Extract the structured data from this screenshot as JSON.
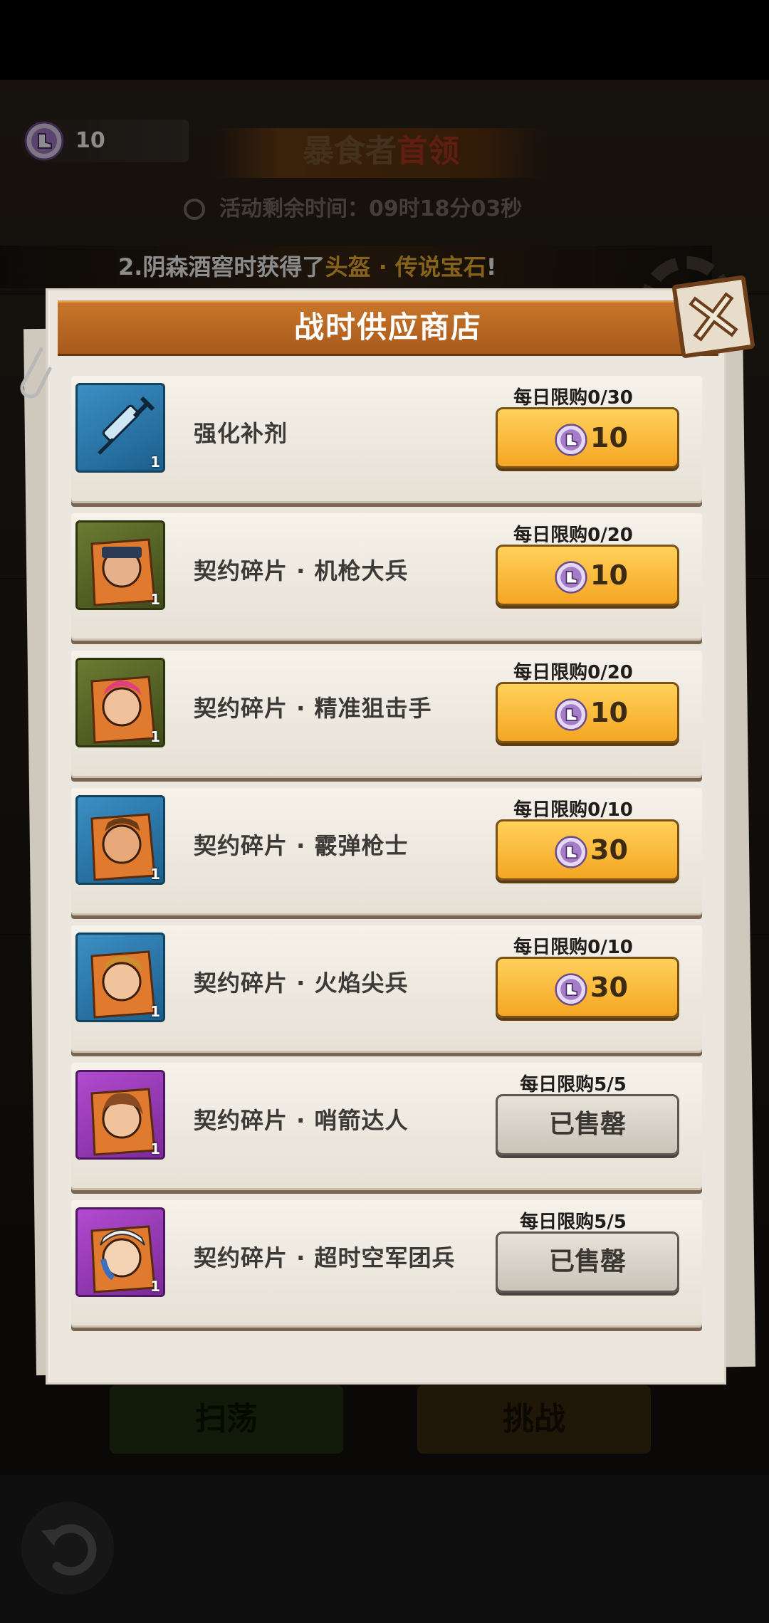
{
  "currency": {
    "amount": "10",
    "icon": "boot-coin-icon"
  },
  "event": {
    "title_main": "暴食者",
    "title_highlight": "首领",
    "timer": "活动剩余时间：09时18分03秒"
  },
  "ticker": {
    "prefix": "2.阴森酒窖时获得了",
    "item": "头盔 · 传说宝石",
    "suffix": "!"
  },
  "shop": {
    "title": "战时供应商店",
    "items": [
      {
        "name": "强化补剂",
        "limit": "每日限购0/30",
        "price": "10",
        "qty": "1",
        "sold": false,
        "frame": "blue",
        "icon": "syringe-icon"
      },
      {
        "name": "契约碎片 · 机枪大兵",
        "limit": "每日限购0/20",
        "price": "10",
        "qty": "1",
        "sold": false,
        "frame": "green",
        "icon": "portrait-icon"
      },
      {
        "name": "契约碎片 · 精准狙击手",
        "limit": "每日限购0/20",
        "price": "10",
        "qty": "1",
        "sold": false,
        "frame": "green",
        "icon": "portrait-icon"
      },
      {
        "name": "契约碎片 · 霰弹枪士",
        "limit": "每日限购0/10",
        "price": "30",
        "qty": "1",
        "sold": false,
        "frame": "blue",
        "icon": "portrait-icon"
      },
      {
        "name": "契约碎片 · 火焰尖兵",
        "limit": "每日限购0/10",
        "price": "30",
        "qty": "1",
        "sold": false,
        "frame": "blue",
        "icon": "portrait-icon"
      },
      {
        "name": "契约碎片 · 哨箭达人",
        "limit": "每日限购5/5",
        "price": "已售罄",
        "qty": "1",
        "sold": true,
        "frame": "purple",
        "icon": "portrait-icon"
      },
      {
        "name": "契约碎片 · 超时空军团兵",
        "limit": "每日限购5/5",
        "price": "已售罄",
        "qty": "1",
        "sold": true,
        "frame": "purple",
        "icon": "portrait-icon"
      }
    ]
  },
  "bottom": {
    "sweep_label": "扫荡",
    "challenge_label": "挑战"
  }
}
